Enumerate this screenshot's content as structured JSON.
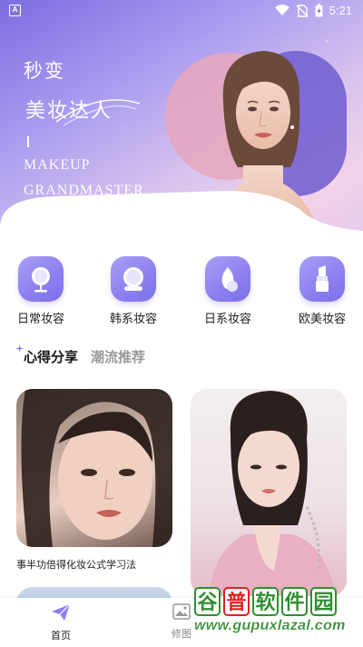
{
  "status_bar": {
    "time": "5:21",
    "app_badge": "A"
  },
  "hero": {
    "line1": "秒变",
    "line2": "美妆达人",
    "en_line1": "MAKEUP",
    "en_line2": "GRANDMASTER"
  },
  "categories": [
    {
      "label": "日常妆容",
      "icon": "mirror-icon"
    },
    {
      "label": "韩系妆容",
      "icon": "compact-icon"
    },
    {
      "label": "日系妆容",
      "icon": "sponge-icon"
    },
    {
      "label": "欧美妆容",
      "icon": "lipstick-icon"
    }
  ],
  "tabs": [
    {
      "label": "心得分享",
      "active": true
    },
    {
      "label": "潮流推荐",
      "active": false
    }
  ],
  "cards": [
    {
      "caption": "事半功倍得化妆公式学习法"
    }
  ],
  "bottom_nav": [
    {
      "label": "首页",
      "icon": "paper-plane-icon",
      "active": true
    },
    {
      "label": "修图",
      "icon": "image-icon",
      "active": false
    }
  ],
  "watermark": {
    "chars": [
      "谷",
      "普",
      "软",
      "件",
      "园"
    ],
    "url": "www.gupuxlazal.com"
  },
  "colors": {
    "accent": "#8b7ff0",
    "hero_gradient_start": "#7d6de0",
    "hero_gradient_end": "#f1d3ea",
    "watermark_green": "#2f8f2f",
    "watermark_red": "#dd2222"
  }
}
